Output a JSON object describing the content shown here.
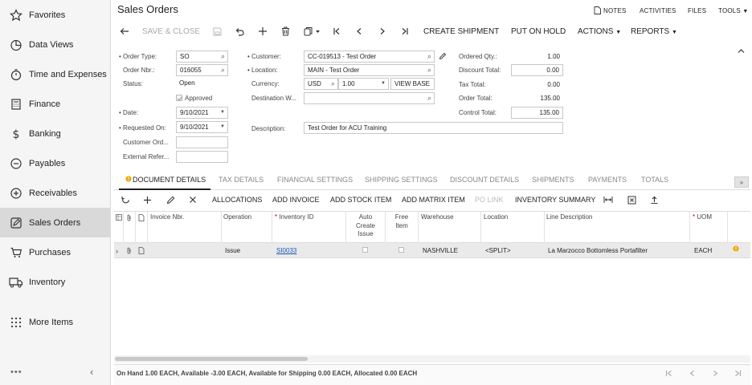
{
  "sidebar": {
    "items": [
      {
        "label": "Favorites",
        "icon": "star-icon"
      },
      {
        "label": "Data Views",
        "icon": "pie-chart-icon"
      },
      {
        "label": "Time and Expenses",
        "icon": "stopwatch-icon"
      },
      {
        "label": "Finance",
        "icon": "calculator-icon"
      },
      {
        "label": "Banking",
        "icon": "dollar-icon"
      },
      {
        "label": "Payables",
        "icon": "minus-circle-icon"
      },
      {
        "label": "Receivables",
        "icon": "plus-circle-icon"
      },
      {
        "label": "Sales Orders",
        "icon": "edit-icon",
        "active": true
      },
      {
        "label": "Purchases",
        "icon": "cart-icon"
      },
      {
        "label": "Inventory",
        "icon": "truck-icon"
      },
      {
        "label": "More Items",
        "icon": "grid-dots-icon"
      }
    ],
    "more": "•••",
    "collapse": "‹"
  },
  "header": {
    "title": "Sales Orders",
    "links": {
      "notes": "NOTES",
      "activities": "ACTIVITIES",
      "files": "FILES",
      "tools": "TOOLS"
    }
  },
  "toolbar": {
    "save_close": "SAVE & CLOSE",
    "create_shipment": "CREATE SHIPMENT",
    "put_on_hold": "PUT ON HOLD",
    "actions": "ACTIONS",
    "reports": "REPORTS"
  },
  "form": {
    "order_type": {
      "label": "Order Type:",
      "value": "SO"
    },
    "order_nbr": {
      "label": "Order Nbr.:",
      "value": "016055"
    },
    "status": {
      "label": "Status:",
      "value": "Open"
    },
    "approved": {
      "label": "Approved",
      "checked": true
    },
    "date": {
      "label": "Date:",
      "value": "9/10/2021"
    },
    "requested_on": {
      "label": "Requested On:",
      "value": "9/10/2021"
    },
    "customer_ord": {
      "label": "Customer Ord...",
      "value": ""
    },
    "external_ref": {
      "label": "External Refer...",
      "value": ""
    },
    "customer": {
      "label": "Customer:",
      "value": "CC-019513 - Test Order"
    },
    "location": {
      "label": "Location:",
      "value": "MAIN - Test  Order"
    },
    "currency": {
      "label": "Currency:",
      "value": "USD",
      "rate": "1.00",
      "view_base": "VIEW BASE"
    },
    "destination_wh": {
      "label": "Destination W...",
      "value": ""
    },
    "description": {
      "label": "Description:",
      "value": "Test Order for ACU Training"
    },
    "ordered_qty": {
      "label": "Ordered Qty.:",
      "value": "1.00"
    },
    "discount_total": {
      "label": "Discount Total:",
      "value": "0.00"
    },
    "tax_total": {
      "label": "Tax Total:",
      "value": "0.00"
    },
    "order_total": {
      "label": "Order Total:",
      "value": "135.00"
    },
    "control_total": {
      "label": "Control Total:",
      "value": "135.00"
    }
  },
  "tabs": [
    {
      "label": "DOCUMENT DETAILS",
      "active": true
    },
    {
      "label": "TAX DETAILS"
    },
    {
      "label": "FINANCIAL SETTINGS"
    },
    {
      "label": "SHIPPING SETTINGS"
    },
    {
      "label": "DISCOUNT DETAILS"
    },
    {
      "label": "SHIPMENTS"
    },
    {
      "label": "PAYMENTS"
    },
    {
      "label": "TOTALS"
    }
  ],
  "grid_toolbar": {
    "allocations": "ALLOCATIONS",
    "add_invoice": "ADD INVOICE",
    "add_stock_item": "ADD STOCK ITEM",
    "add_matrix_item": "ADD MATRIX ITEM",
    "po_link": "PO LINK",
    "inventory_summary": "INVENTORY SUMMARY"
  },
  "grid": {
    "columns": {
      "invoice_nbr": "Invoice Nbr.",
      "operation": "Operation",
      "inventory_id": "Inventory ID",
      "auto_create_issue_1": "Auto",
      "auto_create_issue_2": "Create",
      "auto_create_issue_3": "Issue",
      "free_item_1": "Free",
      "free_item_2": "Item",
      "warehouse": "Warehouse",
      "location": "Location",
      "line_description": "Line Description",
      "uom": "UOM"
    },
    "rows": [
      {
        "invoice_nbr": "",
        "operation": "Issue",
        "inventory_id": "SI0033",
        "warehouse": "NASHVILLE",
        "location": "<SPLIT>",
        "line_description": "La Marzocco Bottomless Portafilter",
        "uom": "EACH"
      }
    ]
  },
  "footer": {
    "status": "On Hand 1.00 EACH, Available -3.00 EACH, Available for Shipping 0.00 EACH, Allocated 0.00 EACH"
  },
  "colors": {
    "accent": "#1a57b8",
    "warning": "#f0a500",
    "active_nav": "#d9d9d9"
  }
}
